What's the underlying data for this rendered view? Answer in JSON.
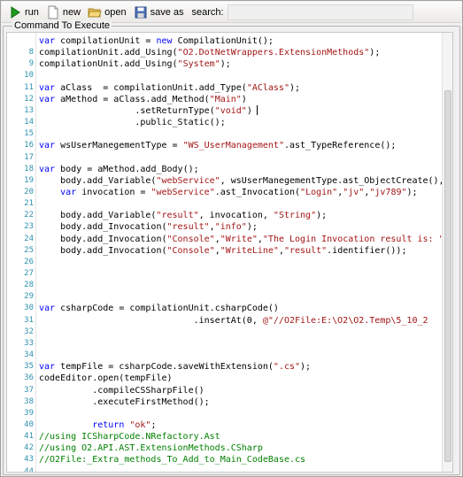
{
  "toolbar": {
    "run_label": "run",
    "new_label": "new",
    "open_label": "open",
    "save_label": "save as",
    "search_label": "search:",
    "search_value": ""
  },
  "group_title": "Command To Execute",
  "colors": {
    "keyword": "#0000ff",
    "string": "#a31515",
    "comment": "#008000",
    "line_number": "#2b91af"
  },
  "icons": {
    "run": "play-icon",
    "new": "new-file-icon",
    "open": "open-folder-icon",
    "save": "save-disk-icon"
  },
  "code_lines": [
    {
      "n": "",
      "segs": [
        {
          "t": "var ",
          "c": "kw"
        },
        {
          "t": "compilationUnit = "
        },
        {
          "t": "new ",
          "c": "kw"
        },
        {
          "t": "CompilationUnit();"
        }
      ]
    },
    {
      "n": "8",
      "segs": [
        {
          "t": "compilationUnit.add_Using("
        },
        {
          "t": "\"O2.DotNetWrappers.ExtensionMethods\"",
          "c": "str"
        },
        {
          "t": ");"
        }
      ]
    },
    {
      "n": "9",
      "segs": [
        {
          "t": "compilationUnit.add_Using("
        },
        {
          "t": "\"System\"",
          "c": "str"
        },
        {
          "t": ");"
        }
      ]
    },
    {
      "n": "10",
      "segs": []
    },
    {
      "n": "11",
      "segs": [
        {
          "t": "var ",
          "c": "kw"
        },
        {
          "t": "aClass  = compilationUnit.add_Type("
        },
        {
          "t": "\"AClass\"",
          "c": "str"
        },
        {
          "t": ");"
        }
      ]
    },
    {
      "n": "12",
      "segs": [
        {
          "t": "var ",
          "c": "kw"
        },
        {
          "t": "aMethod = aClass.add_Method("
        },
        {
          "t": "\"Main\"",
          "c": "str"
        },
        {
          "t": ")"
        }
      ]
    },
    {
      "n": "13",
      "segs": [
        {
          "t": "                  .setReturnType("
        },
        {
          "t": "\"void\"",
          "c": "str"
        },
        {
          "t": ")"
        }
      ],
      "caret": true
    },
    {
      "n": "14",
      "segs": [
        {
          "t": "                  .public_Static();"
        }
      ]
    },
    {
      "n": "15",
      "segs": []
    },
    {
      "n": "16",
      "segs": [
        {
          "t": "var ",
          "c": "kw"
        },
        {
          "t": "wsUserManegementType = "
        },
        {
          "t": "\"WS_UserManagement\"",
          "c": "str"
        },
        {
          "t": ".ast_TypeReference();"
        }
      ]
    },
    {
      "n": "17",
      "segs": []
    },
    {
      "n": "18",
      "segs": [
        {
          "t": "var ",
          "c": "kw"
        },
        {
          "t": "body = aMethod.add_Body();"
        }
      ]
    },
    {
      "n": "19",
      "segs": [
        {
          "t": "    body.add_Variable("
        },
        {
          "t": "\"webService\"",
          "c": "str"
        },
        {
          "t": ", wsUserManegementType.ast_ObjectCreate(),"
        }
      ]
    },
    {
      "n": "20",
      "segs": [
        {
          "t": "    "
        },
        {
          "t": "var ",
          "c": "kw"
        },
        {
          "t": "invocation = "
        },
        {
          "t": "\"webService\"",
          "c": "str"
        },
        {
          "t": ".ast_Invocation("
        },
        {
          "t": "\"Login\"",
          "c": "str"
        },
        {
          "t": ","
        },
        {
          "t": "\"jv\"",
          "c": "str"
        },
        {
          "t": ","
        },
        {
          "t": "\"jv789\"",
          "c": "str"
        },
        {
          "t": ");"
        }
      ]
    },
    {
      "n": "21",
      "segs": []
    },
    {
      "n": "22",
      "segs": [
        {
          "t": "    body.add_Variable("
        },
        {
          "t": "\"result\"",
          "c": "str"
        },
        {
          "t": ", invocation, "
        },
        {
          "t": "\"String\"",
          "c": "str"
        },
        {
          "t": ");"
        }
      ]
    },
    {
      "n": "23",
      "segs": [
        {
          "t": "    body.add_Invocation("
        },
        {
          "t": "\"result\"",
          "c": "str"
        },
        {
          "t": ","
        },
        {
          "t": "\"info\"",
          "c": "str"
        },
        {
          "t": ");"
        }
      ]
    },
    {
      "n": "24",
      "segs": [
        {
          "t": "    body.add_Invocation("
        },
        {
          "t": "\"Console\"",
          "c": "str"
        },
        {
          "t": ","
        },
        {
          "t": "\"Write\"",
          "c": "str"
        },
        {
          "t": ","
        },
        {
          "t": "\"The Login Invocation result is: \"",
          "c": "str"
        }
      ]
    },
    {
      "n": "25",
      "segs": [
        {
          "t": "    body.add_Invocation("
        },
        {
          "t": "\"Console\"",
          "c": "str"
        },
        {
          "t": ","
        },
        {
          "t": "\"WriteLine\"",
          "c": "str"
        },
        {
          "t": ","
        },
        {
          "t": "\"result\"",
          "c": "str"
        },
        {
          "t": ".identifier());"
        }
      ]
    },
    {
      "n": "26",
      "segs": []
    },
    {
      "n": "27",
      "segs": []
    },
    {
      "n": "28",
      "segs": []
    },
    {
      "n": "29",
      "segs": []
    },
    {
      "n": "30",
      "segs": [
        {
          "t": "var ",
          "c": "kw"
        },
        {
          "t": "csharpCode = compilationUnit.csharpCode()"
        }
      ]
    },
    {
      "n": "31",
      "segs": [
        {
          "t": "                             .insertAt(0, "
        },
        {
          "t": "@\"//O2File:E:\\O2\\O2.Temp\\5_10_2",
          "c": "str"
        }
      ]
    },
    {
      "n": "32",
      "segs": []
    },
    {
      "n": "33",
      "segs": []
    },
    {
      "n": "34",
      "segs": []
    },
    {
      "n": "35",
      "segs": [
        {
          "t": "var ",
          "c": "kw"
        },
        {
          "t": "tempFile = csharpCode.saveWithExtension("
        },
        {
          "t": "\".cs\"",
          "c": "str"
        },
        {
          "t": ");"
        }
      ]
    },
    {
      "n": "36",
      "segs": [
        {
          "t": "codeEditor.open(tempFile)"
        }
      ]
    },
    {
      "n": "37",
      "segs": [
        {
          "t": "          .compileCSSharpFile()"
        }
      ]
    },
    {
      "n": "38",
      "segs": [
        {
          "t": "          .executeFirstMethod();"
        }
      ]
    },
    {
      "n": "39",
      "segs": []
    },
    {
      "n": "40",
      "segs": [
        {
          "t": "          "
        },
        {
          "t": "return ",
          "c": "kw"
        },
        {
          "t": "\"ok\"",
          "c": "str"
        },
        {
          "t": ";"
        }
      ]
    },
    {
      "n": "41",
      "segs": [
        {
          "t": "//using ICSharpCode.NRefactory.Ast",
          "c": "cm"
        }
      ]
    },
    {
      "n": "42",
      "segs": [
        {
          "t": "//using O2.API.AST.ExtensionMethods.CSharp",
          "c": "cm"
        }
      ]
    },
    {
      "n": "43",
      "segs": [
        {
          "t": "//O2File:_Extra_methods_To_Add_to_Main_CodeBase.cs",
          "c": "cm"
        }
      ]
    },
    {
      "n": "44",
      "segs": []
    }
  ]
}
